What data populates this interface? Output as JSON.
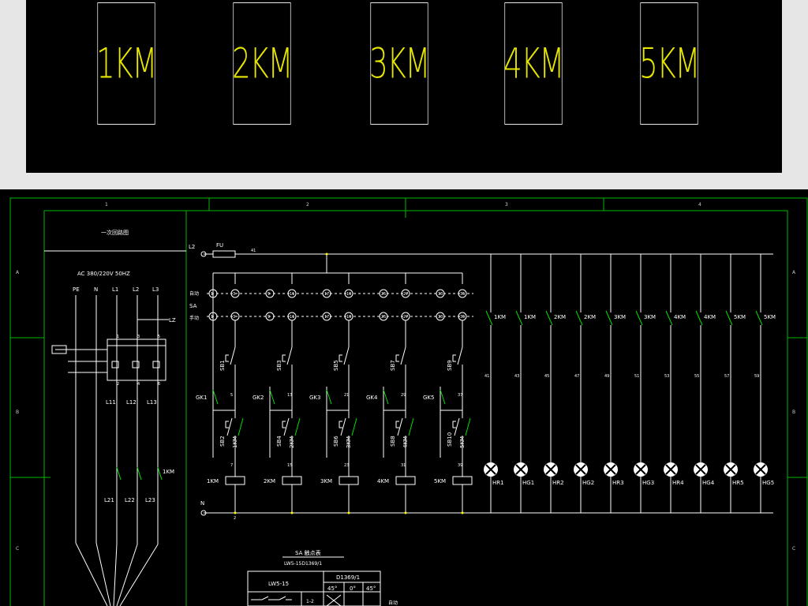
{
  "top_boxes": [
    "1KM",
    "2KM",
    "3KM",
    "4KM",
    "5KM"
  ],
  "grid_columns": [
    "1",
    "2",
    "3",
    "4"
  ],
  "grid_rows": [
    "A",
    "B",
    "C"
  ],
  "left_section": {
    "title": "一次回路图",
    "supply": "AC 380/220V 50HZ",
    "phases": [
      "PE",
      "N",
      "L1",
      "L2",
      "L3"
    ],
    "l_labels_1": [
      "L11",
      "L12",
      "L13"
    ],
    "l_labels_2": [
      "L21",
      "L22",
      "L23"
    ],
    "lz_label": "LZ",
    "contactor_label": "1KM",
    "term_nums": [
      "1",
      "3",
      "5",
      "2",
      "4",
      "6"
    ]
  },
  "control": {
    "l2_label": "L2",
    "fu_label": "FU",
    "wire_1": "41",
    "sa_label": "SA",
    "auto_label": "自动",
    "manual_label": "手动",
    "n_label": "N",
    "sb_top": [
      "SB1",
      "SB3",
      "SB5",
      "SB7",
      "SB9"
    ],
    "sb_bottom": [
      "SB2",
      "SB4",
      "SB6",
      "SB8",
      "SB10"
    ],
    "gk": [
      "GK1",
      "GK2",
      "GK3",
      "GK4",
      "GK5"
    ],
    "km_aux": [
      "1KM",
      "2KM",
      "3KM",
      "4KM",
      "5KM"
    ],
    "coils": [
      "1KM",
      "2KM",
      "3KM",
      "4KM",
      "5KM"
    ],
    "wire_top": [
      "1",
      "3",
      "9",
      "11",
      "17",
      "19",
      "25",
      "27",
      "33",
      "35"
    ],
    "wire_mid": [
      "5",
      "13",
      "21",
      "29",
      "37"
    ],
    "wire_low": [
      "7",
      "15",
      "23",
      "31",
      "39"
    ],
    "bottom_terminal": "2"
  },
  "lamps": {
    "contacts": [
      "1KM",
      "1KM",
      "2KM",
      "2KM",
      "3KM",
      "3KM",
      "4KM",
      "4KM",
      "5KM",
      "5KM"
    ],
    "wires": [
      "41",
      "43",
      "45",
      "47",
      "49",
      "51",
      "53",
      "55",
      "57",
      "59"
    ],
    "labels": [
      "HR1",
      "HG1",
      "HR2",
      "HG2",
      "HR3",
      "HG3",
      "HR4",
      "HG4",
      "HR5",
      "HG5"
    ]
  },
  "sa_table": {
    "title": "SA 触点表",
    "model": "LW5-15D1369/1",
    "header_left": "LW5-15",
    "header_right": "D1369/1",
    "angles": [
      "45°",
      "0°",
      "45°"
    ],
    "row1_contact": "1-2",
    "side_label": "自动"
  },
  "colors": {
    "line": "#ffffff",
    "frame": "#00b800",
    "switch": "#00e000",
    "km_text": "#e6e600",
    "dot": "#ffff00"
  }
}
